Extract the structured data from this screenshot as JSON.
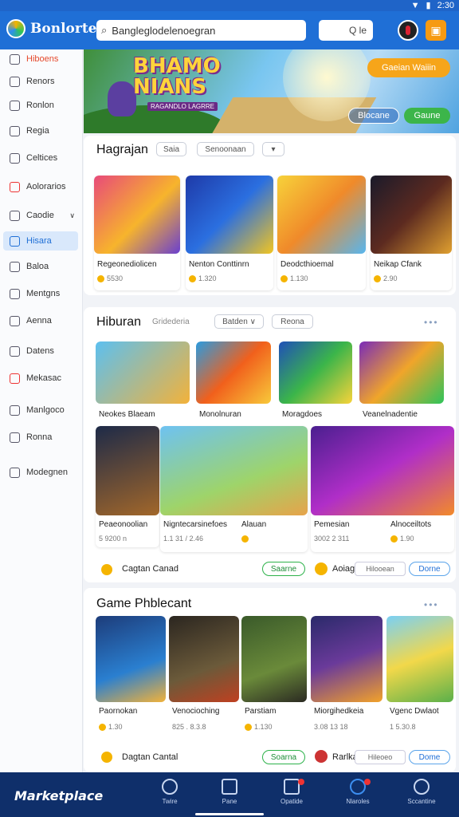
{
  "status": {
    "time": "2:30"
  },
  "app": {
    "name": "Bonlorte"
  },
  "search": {
    "value": "Bangleglodelenoegran",
    "secondary": "Q le"
  },
  "sidebar": {
    "items": [
      {
        "label": "Hiboens"
      },
      {
        "label": "Renors"
      },
      {
        "label": "Ronlon"
      },
      {
        "label": "Regia"
      },
      {
        "label": "Celtices"
      },
      {
        "label": "Aolorarios"
      },
      {
        "label": "Caodie"
      },
      {
        "label": "Hisara"
      },
      {
        "label": "Baloa"
      },
      {
        "label": "Mentgns"
      },
      {
        "label": "Aenna"
      },
      {
        "label": "Datens"
      },
      {
        "label": "Mekasac"
      },
      {
        "label": "Manlgoco"
      },
      {
        "label": "Ronna"
      },
      {
        "label": "Modegnen"
      }
    ]
  },
  "banner": {
    "title_line1": "BHAMO",
    "title_line2": "NIANS",
    "subtitle": "RAGANDLO LAGRRE",
    "cta_primary": "Gaeian Waiiin",
    "cta_secondary": "Blocane",
    "cta_tertiary": "Gaune"
  },
  "section1": {
    "title": "Hagrajan",
    "filter1": "Saia",
    "filter2": "Senoonaan",
    "filter3": "▾",
    "cards": [
      {
        "name": "Regeonediolicen",
        "value": "5530"
      },
      {
        "name": "Nenton Conttinrn",
        "value": "1.320"
      },
      {
        "name": "Deodcthioemal",
        "value": "1.130"
      },
      {
        "name": "Neikap Cfank",
        "value": "2.90"
      }
    ]
  },
  "section2": {
    "title": "Hiburan",
    "subtitle": "Gridederia",
    "filter1": "Batden ∨",
    "filter2": "Reona",
    "row1": [
      {
        "name": "Neokes Blaeam"
      },
      {
        "name": "Monolnuran"
      },
      {
        "name": "Moragdoes"
      },
      {
        "name": "Veanelnadentie"
      }
    ],
    "row2": [
      {
        "name": "Peaeonoolian",
        "value": "5 9200 n"
      },
      {
        "name": "Nigntecarsinefoes",
        "value": "1.1 31 / 2.46"
      },
      {
        "name": "Alauan",
        "value": ""
      },
      {
        "name": "Pemesian",
        "value": "3002 2 311"
      },
      {
        "name": "Alnoceiltots",
        "value": "1.90"
      }
    ],
    "footer": {
      "label": "Cagtan Canad",
      "btn1": "Saarne",
      "label2": "Aoiag",
      "btn2": "Hilooean",
      "btn3": "Dorne"
    }
  },
  "section3": {
    "title": "Game Phblecant",
    "cards": [
      {
        "name": "Paornokan",
        "value": "1.30"
      },
      {
        "name": "Venocioching",
        "value": "825 . 8.3.8"
      },
      {
        "name": "Parstiam",
        "value": "1.130"
      },
      {
        "name": "Miorgihedkeia",
        "value": "3.08 13 18"
      },
      {
        "name": "Vgenc Dwlaot",
        "value": "1 5.30.8"
      }
    ],
    "footer": {
      "label": "Dagtan Cantal",
      "btn1": "Soarna",
      "label2": "Rarlka",
      "btn2": "Hileoeo",
      "btn3": "Dome"
    }
  },
  "bottomnav": {
    "brand": "Marketplace",
    "items": [
      {
        "label": "Twire"
      },
      {
        "label": "Pane"
      },
      {
        "label": "Opatide"
      },
      {
        "label": "Nlaroles"
      },
      {
        "label": "Sccantine"
      }
    ]
  }
}
